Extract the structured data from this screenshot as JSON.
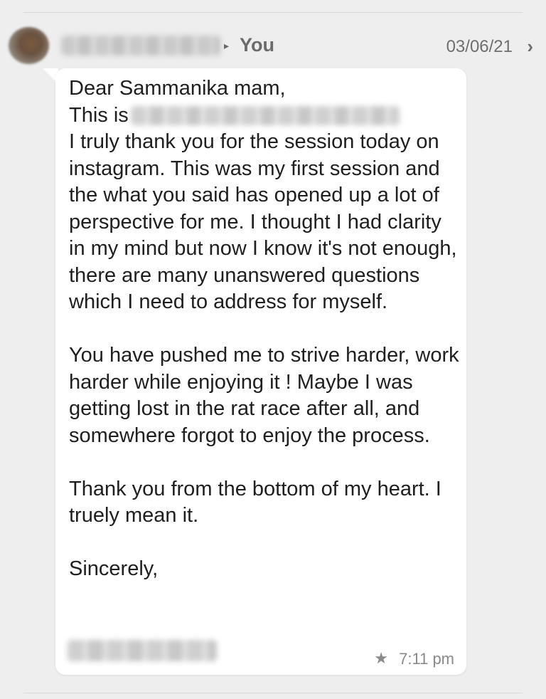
{
  "header": {
    "recipient_label": "You",
    "date": "03/06/21",
    "chevron_icon": "chevron-right-icon"
  },
  "message": {
    "greeting": "Dear Sammanika mam,",
    "this_is": "This is",
    "body_1": "I truly thank you for the session today on instagram. This was my first session and the what you said has opened up a lot of perspective for me. I thought I had clarity in my mind but now I know it's not enough, there are many unanswered questions which I need to address for myself.",
    "body_2": "You have pushed me to strive harder, work harder while enjoying it ! Maybe I was getting lost in the rat race after all, and somewhere forgot to enjoy the process.",
    "body_3": "Thank you from the bottom of my heart. I truely mean it.",
    "closing": "Sincerely,",
    "time": "7:11 pm",
    "star_icon": "star-icon"
  }
}
